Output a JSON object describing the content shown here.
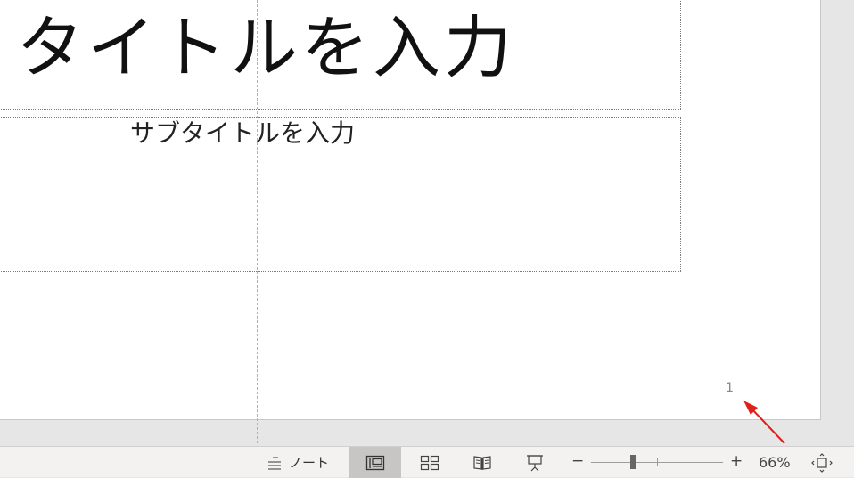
{
  "slide": {
    "title_placeholder": "タイトルを入力",
    "subtitle_placeholder": "サブタイトルを入力",
    "slide_number": "1"
  },
  "annotation": {
    "arrow_color": "#e0201a"
  },
  "statusbar": {
    "notes_label": "ノート",
    "zoom_minus": "−",
    "zoom_plus": "+",
    "zoom_level": "66%",
    "zoom_value_percent": 66,
    "views": [
      {
        "name": "normal-view",
        "active": true
      },
      {
        "name": "slide-sorter-view",
        "active": false
      },
      {
        "name": "reading-view",
        "active": false
      },
      {
        "name": "slide-show-view",
        "active": false
      }
    ]
  },
  "colors": {
    "canvas_bg": "#e6e6e6",
    "slide_bg": "#ffffff",
    "statusbar_bg": "#f3f2f1",
    "active_view_bg": "#c8c6c4"
  },
  "icons": {
    "notes": "notes-icon",
    "normal_view": "normal-view-icon",
    "slide_sorter": "slide-sorter-icon",
    "reading_view": "reading-view-icon",
    "slide_show": "slide-show-icon",
    "fit_to_window": "fit-to-window-icon"
  }
}
